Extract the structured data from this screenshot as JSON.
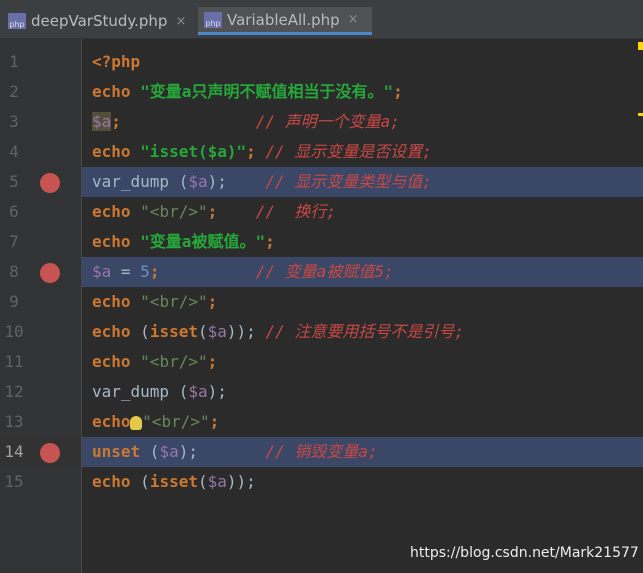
{
  "tabs": [
    {
      "label": "deepVarStudy.php",
      "icon": "php-file-icon",
      "active": false
    },
    {
      "label": "VariableAll.php",
      "icon": "php-file-icon",
      "active": true
    }
  ],
  "php_icon_text": "php",
  "close_glyph": "×",
  "lines": [
    {
      "num": "1",
      "breakpoint": false,
      "tokens": [
        {
          "t": "<?php",
          "c": "kw"
        }
      ]
    },
    {
      "num": "2",
      "breakpoint": false,
      "tokens": [
        {
          "t": "echo ",
          "c": "kw"
        },
        {
          "t": "\"变量a只声明不赋值相当于没有。\"",
          "c": "strb"
        },
        {
          "t": ";",
          "c": "kw"
        }
      ]
    },
    {
      "num": "3",
      "breakpoint": false,
      "tokens": [
        {
          "t": "$a",
          "c": "var varhl"
        },
        {
          "t": ";",
          "c": "kw"
        },
        {
          "t": "              ",
          "c": ""
        },
        {
          "t": "// 声明一个变量a;",
          "c": "cmt"
        }
      ]
    },
    {
      "num": "4",
      "breakpoint": false,
      "tokens": [
        {
          "t": "echo ",
          "c": "kw"
        },
        {
          "t": "\"isset($a)\"",
          "c": "strb"
        },
        {
          "t": "; ",
          "c": "kw"
        },
        {
          "t": "// 显示变量是否设置;",
          "c": "cmt"
        }
      ]
    },
    {
      "num": "5",
      "breakpoint": true,
      "tokens": [
        {
          "t": "var_dump ",
          "c": "fn"
        },
        {
          "t": "(",
          "c": "fn"
        },
        {
          "t": "$a",
          "c": "var"
        },
        {
          "t": ");",
          "c": "fn"
        },
        {
          "t": "    ",
          "c": ""
        },
        {
          "t": "// 显示变量类型与值;",
          "c": "cmt"
        }
      ]
    },
    {
      "num": "6",
      "breakpoint": false,
      "tokens": [
        {
          "t": "echo ",
          "c": "kw"
        },
        {
          "t": "\"<br/>\"",
          "c": "str"
        },
        {
          "t": ";",
          "c": "kw"
        },
        {
          "t": "    ",
          "c": ""
        },
        {
          "t": "//  换行;",
          "c": "cmt"
        }
      ]
    },
    {
      "num": "7",
      "breakpoint": false,
      "tokens": [
        {
          "t": "echo ",
          "c": "kw"
        },
        {
          "t": "\"变量a被赋值。\"",
          "c": "strb"
        },
        {
          "t": ";",
          "c": "kw"
        }
      ]
    },
    {
      "num": "8",
      "breakpoint": true,
      "tokens": [
        {
          "t": "$a",
          "c": "var"
        },
        {
          "t": " = ",
          "c": "fn"
        },
        {
          "t": "5",
          "c": "num"
        },
        {
          "t": ";",
          "c": "kw"
        },
        {
          "t": "          ",
          "c": ""
        },
        {
          "t": "// 变量a被赋值5;",
          "c": "cmt"
        }
      ]
    },
    {
      "num": "9",
      "breakpoint": false,
      "tokens": [
        {
          "t": "echo ",
          "c": "kw"
        },
        {
          "t": "\"<br/>\"",
          "c": "str"
        },
        {
          "t": ";",
          "c": "kw"
        }
      ]
    },
    {
      "num": "10",
      "breakpoint": false,
      "tokens": [
        {
          "t": "echo ",
          "c": "kw"
        },
        {
          "t": "(",
          "c": "fn"
        },
        {
          "t": "isset",
          "c": "kw"
        },
        {
          "t": "(",
          "c": "fn"
        },
        {
          "t": "$a",
          "c": "var"
        },
        {
          "t": "));",
          "c": "fn"
        },
        {
          "t": " ",
          "c": ""
        },
        {
          "t": "// 注意要用括号不是引号;",
          "c": "cmt"
        }
      ]
    },
    {
      "num": "11",
      "breakpoint": false,
      "tokens": [
        {
          "t": "echo ",
          "c": "kw"
        },
        {
          "t": "\"<br/>\"",
          "c": "str"
        },
        {
          "t": ";",
          "c": "kw"
        }
      ]
    },
    {
      "num": "12",
      "breakpoint": false,
      "tokens": [
        {
          "t": "var_dump ",
          "c": "fn"
        },
        {
          "t": "(",
          "c": "fn"
        },
        {
          "t": "$a",
          "c": "var"
        },
        {
          "t": ");",
          "c": "fn"
        }
      ]
    },
    {
      "num": "13",
      "breakpoint": false,
      "tokens": [
        {
          "t": "echo ",
          "c": "kw"
        },
        {
          "t": "\"<br/>\"",
          "c": "str"
        },
        {
          "t": ";",
          "c": "kw"
        }
      ],
      "bulb": true
    },
    {
      "num": "14",
      "breakpoint": true,
      "current": true,
      "tokens": [
        {
          "t": "unset ",
          "c": "kw"
        },
        {
          "t": "(",
          "c": "fn"
        },
        {
          "t": "$a",
          "c": "var"
        },
        {
          "t": ");",
          "c": "fn"
        },
        {
          "t": "       ",
          "c": ""
        },
        {
          "t": "// 销毁变量a;",
          "c": "cmt"
        }
      ]
    },
    {
      "num": "15",
      "breakpoint": false,
      "tokens": [
        {
          "t": "echo ",
          "c": "kw"
        },
        {
          "t": "(",
          "c": "fn"
        },
        {
          "t": "isset",
          "c": "kw"
        },
        {
          "t": "(",
          "c": "fn"
        },
        {
          "t": "$a",
          "c": "var"
        },
        {
          "t": "));",
          "c": "fn"
        }
      ]
    }
  ],
  "watermark": "https://blog.csdn.net/Mark21577",
  "colors": {
    "breakpoint": "#c75450",
    "breakpoint_line": "#3a4766",
    "keyword": "#cc7832",
    "string": "#25a839",
    "comment": "#c94844",
    "variable": "#9876aa",
    "number": "#6897bb"
  }
}
